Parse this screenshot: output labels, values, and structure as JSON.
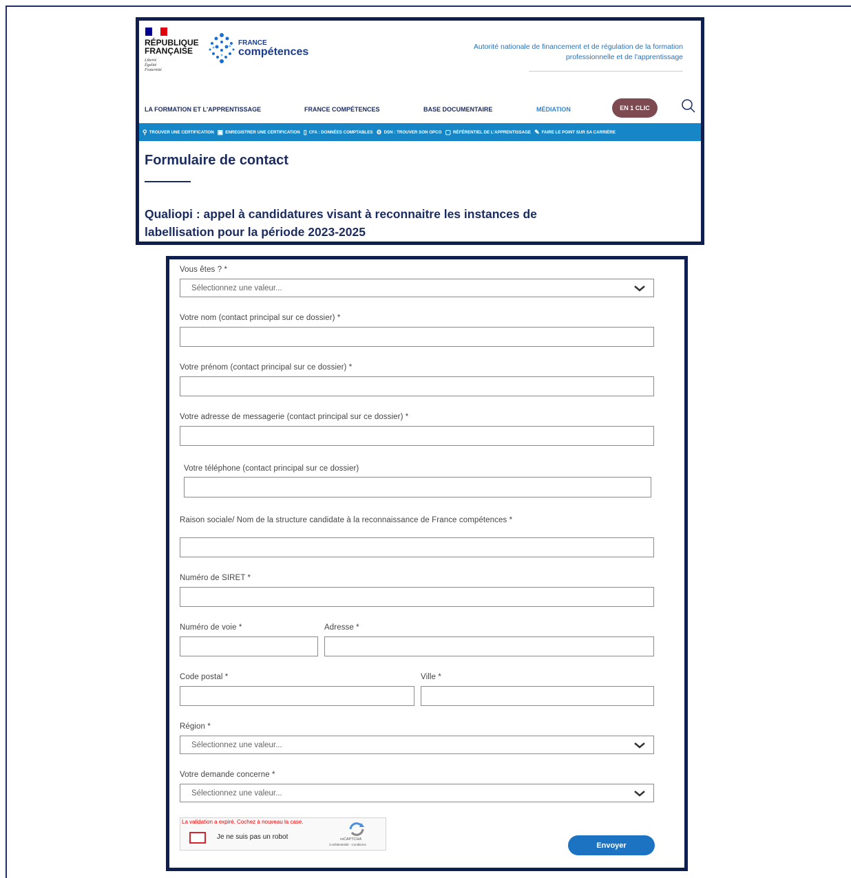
{
  "header": {
    "republic_name": "RÉPUBLIQUE\nFRANÇAISE",
    "motto": "Liberté\nÉgalité\nFraternité",
    "brand_small": "FRANCE",
    "brand_large": "compétences",
    "authority": "Autorité nationale de financement et de régulation de la formation professionnelle et de l'apprentissage",
    "nav": [
      "LA FORMATION ET L'APPRENTISSAGE",
      "FRANCE COMPÉTENCES",
      "BASE DOCUMENTAIRE",
      "MÉDIATION"
    ],
    "cta": "EN 1 CLIC",
    "quicklinks": [
      {
        "icon": "search-icon",
        "label": "TROUVER UNE CERTIFICATION"
      },
      {
        "icon": "save-icon",
        "label": "ENREGISTRER UNE CERTIFICATION"
      },
      {
        "icon": "document-icon",
        "label": "CFA : DONNÉES COMPTABLES"
      },
      {
        "icon": "gear-icon",
        "label": "DSN : TROUVER SON OPCO"
      },
      {
        "icon": "clipboard-icon",
        "label": "RÉFÉRENTIEL DE L'APPRENTISSAGE"
      },
      {
        "icon": "pen-icon",
        "label": "FAIRE LE POINT SUR SA CARRIÈRE"
      }
    ],
    "page_title": "Formulaire de contact",
    "subtitle": "Qualiopi : appel à candidatures visant à reconnaitre les instances de labellisation pour la période 2023-2025"
  },
  "form": {
    "vous_etes_label": "Vous êtes ? *",
    "select_placeholder": "Sélectionnez une valeur...",
    "nom_label": "Votre nom (contact principal sur ce dossier) *",
    "prenom_label": "Votre prénom (contact principal sur ce dossier) *",
    "email_label": "Votre adresse de messagerie (contact principal sur ce dossier) *",
    "tel_label": "Votre téléphone (contact principal sur ce dossier)",
    "raison_label": "Raison sociale/ Nom de la structure candidate à la reconnaissance de France compétences *",
    "siret_label": "Numéro de SIRET *",
    "voie_label": "Numéro de voie *",
    "adresse_label": "Adresse *",
    "cp_label": "Code postal *",
    "ville_label": "Ville *",
    "region_label": "Région *",
    "demande_label": "Votre demande concerne *",
    "captcha_error": "La validation a expiré. Cochez à nouveau la case.",
    "captcha_text": "Je ne suis pas un robot",
    "captcha_brand": "reCAPTCHA",
    "captcha_terms": "Confidentialité - Conditions",
    "submit": "Envoyer"
  },
  "colors": {
    "navy": "#1a2b5f",
    "bluebar": "#1686c7",
    "cta": "#7d4a52",
    "submit": "#1c73c2"
  }
}
